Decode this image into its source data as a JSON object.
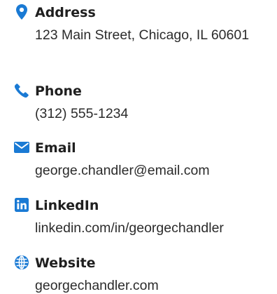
{
  "accent_color": "#1a7ad4",
  "contacts": [
    {
      "icon": "map-pin-icon",
      "label": "Address",
      "value": "123 Main Street, Chicago, IL 60601"
    },
    {
      "icon": "phone-icon",
      "label": "Phone",
      "value": "(312) 555-1234"
    },
    {
      "icon": "envelope-icon",
      "label": "Email",
      "value": "george.chandler@email.com"
    },
    {
      "icon": "linkedin-icon",
      "label": "LinkedIn",
      "value": "linkedin.com/in/georgechandler"
    },
    {
      "icon": "globe-icon",
      "label": "Website",
      "value": "georgechandler.com"
    }
  ]
}
